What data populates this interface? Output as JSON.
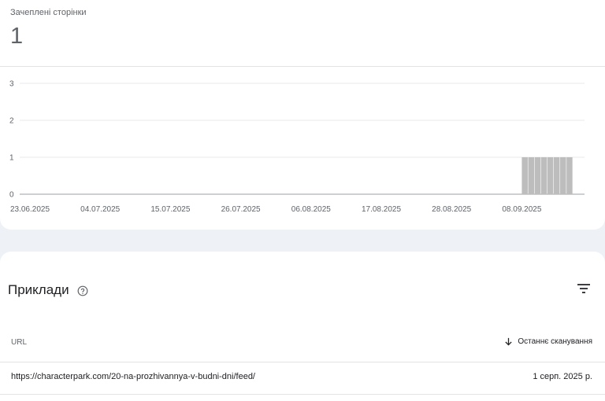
{
  "metric": {
    "label": "Зачеплені сторінки",
    "value": "1"
  },
  "chart_data": {
    "type": "bar",
    "ylim": [
      0,
      3
    ],
    "y_ticks": [
      "0",
      "1",
      "2",
      "3"
    ],
    "x_ticks": [
      "23.06.2025",
      "04.07.2025",
      "15.07.2025",
      "26.07.2025",
      "06.08.2025",
      "17.08.2025",
      "28.08.2025",
      "08.09.2025"
    ],
    "x_start": "2025-06-23",
    "x_end": "2025-09-21",
    "bars": [
      {
        "date": "2025-09-08",
        "value": 1
      },
      {
        "date": "2025-09-09",
        "value": 1
      },
      {
        "date": "2025-09-10",
        "value": 1
      },
      {
        "date": "2025-09-11",
        "value": 1
      },
      {
        "date": "2025-09-12",
        "value": 1
      },
      {
        "date": "2025-09-13",
        "value": 1
      },
      {
        "date": "2025-09-14",
        "value": 1
      },
      {
        "date": "2025-09-15",
        "value": 1
      }
    ],
    "bar_color": "#bdbdbd",
    "grid": true
  },
  "examples": {
    "title": "Приклади",
    "help_icon": "help-circle-icon",
    "filter_icon": "filter-icon",
    "columns": {
      "url": "URL",
      "last_crawl": "Останнє сканування"
    },
    "rows": [
      {
        "url": "https://characterpark.com/20-na-prozhivannya-v-budni-dni/feed/",
        "date": "1 серп. 2025 р."
      }
    ]
  }
}
